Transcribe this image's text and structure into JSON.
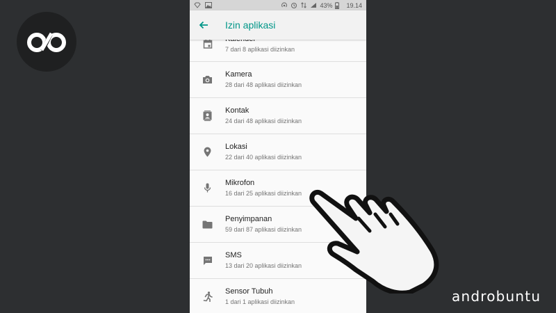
{
  "status_bar": {
    "battery": "43%",
    "time": "19.14"
  },
  "app_bar": {
    "title": "Izin aplikasi",
    "back_icon": "arrow-back-icon"
  },
  "permissions": [
    {
      "icon": "calendar-icon",
      "title": "Kalender",
      "subtitle": "7 dari 8 aplikasi diizinkan"
    },
    {
      "icon": "camera-icon",
      "title": "Kamera",
      "subtitle": "28 dari 48 aplikasi diizinkan"
    },
    {
      "icon": "contacts-icon",
      "title": "Kontak",
      "subtitle": "24 dari 48 aplikasi diizinkan"
    },
    {
      "icon": "location-icon",
      "title": "Lokasi",
      "subtitle": "22 dari 40 aplikasi diizinkan"
    },
    {
      "icon": "microphone-icon",
      "title": "Mikrofon",
      "subtitle": "16 dari 25 aplikasi diizinkan"
    },
    {
      "icon": "folder-icon",
      "title": "Penyimpanan",
      "subtitle": "59 dari 87 aplikasi diizinkan"
    },
    {
      "icon": "sms-icon",
      "title": "SMS",
      "subtitle": "13 dari 20 aplikasi diizinkan"
    },
    {
      "icon": "body-sensor-icon",
      "title": "Sensor Tubuh",
      "subtitle": "1 dari 1 aplikasi diizinkan"
    }
  ],
  "watermark": {
    "brand": "androbuntu",
    "logo_icon": "androbuntu-logo-icon",
    "pointer_icon": "hand-pointer-icon"
  },
  "colors": {
    "accent": "#009688",
    "background": "#2d2f31",
    "icon_gray": "#757575"
  }
}
